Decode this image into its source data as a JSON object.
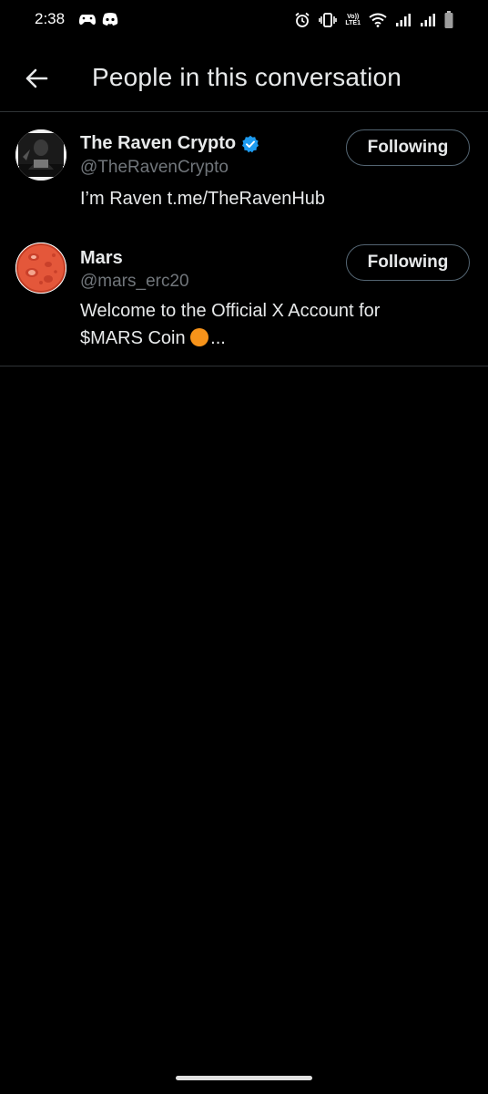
{
  "status_bar": {
    "time": "2:38",
    "icons": [
      "game-controller-icon",
      "discord-icon",
      "alarm-icon",
      "vibrate-icon",
      "volte-icon",
      "wifi-icon",
      "signal-icon",
      "signal-icon",
      "battery-icon"
    ],
    "volte_label_top": "Vo))",
    "volte_label_bottom": "LTE1"
  },
  "header": {
    "back_icon": "back-arrow-icon",
    "title": "People in this conversation"
  },
  "people": [
    {
      "display_name": "The Raven Crypto",
      "verified": true,
      "handle": "@TheRavenCrypto",
      "bio": "I’m Raven t.me/TheRavenHub",
      "button_label": "Following",
      "avatar": "raven-avatar"
    },
    {
      "display_name": "Mars",
      "verified": false,
      "handle": "@mars_erc20",
      "bio_line1": "Welcome to the Official X Account for",
      "bio_line2_text": "$MARS Coin",
      "bio_line2_suffix": "...",
      "bio_emoji": "orange-circle-emoji",
      "button_label": "Following",
      "avatar": "mars-planet-avatar"
    }
  ],
  "colors": {
    "background": "#000000",
    "primary_text": "#e7e9ea",
    "secondary_text": "#71767b",
    "divider": "#2f3336",
    "verified_blue": "#1d9bf0",
    "button_border": "#536471"
  }
}
